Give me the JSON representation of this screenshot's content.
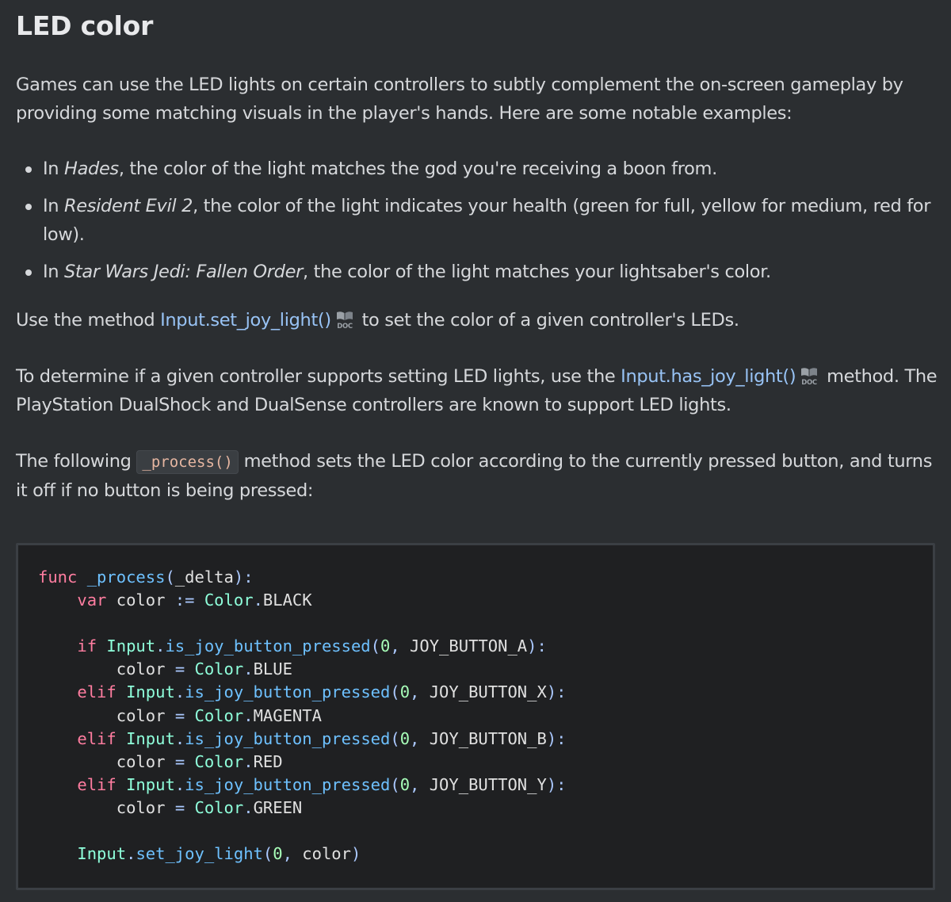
{
  "heading": "LED color",
  "intro": "Games can use the LED lights on certain controllers to subtly complement the on-screen gameplay by providing some matching visuals in the player's hands. Here are some notable examples:",
  "examples": [
    {
      "prefix": "In ",
      "game": "Hades",
      "rest": ", the color of the light matches the god you're receiving a boon from."
    },
    {
      "prefix": "In ",
      "game": "Resident Evil 2",
      "rest": ", the color of the light indicates your health (green for full, yellow for medium, red for low)."
    },
    {
      "prefix": "In ",
      "game": "Star Wars Jedi: Fallen Order",
      "rest": ", the color of the light matches your lightsaber's color."
    }
  ],
  "method_paragraph": {
    "before": "Use the method ",
    "link": "Input.set_joy_light()",
    "after": " to set the color of a given controller's LEDs."
  },
  "has_paragraph": {
    "before": "To determine if a given controller supports setting LED lights, use the ",
    "link": "Input.has_joy_light()",
    "after": " method. The PlayStation DualShock and DualSense controllers are known to support LED lights."
  },
  "process_paragraph": {
    "before": "The following ",
    "code": "_process()",
    "after": " method sets the LED color according to the currently pressed button, and turns it off if no button is being pressed:"
  },
  "doc_badge_label": "DOC",
  "code_lines": [
    "func _process(_delta):",
    "    var color := Color.BLACK",
    "",
    "    if Input.is_joy_button_pressed(0, JOY_BUTTON_A):",
    "        color = Color.BLUE",
    "    elif Input.is_joy_button_pressed(0, JOY_BUTTON_X):",
    "        color = Color.MAGENTA",
    "    elif Input.is_joy_button_pressed(0, JOY_BUTTON_B):",
    "        color = Color.RED",
    "    elif Input.is_joy_button_pressed(0, JOY_BUTTON_Y):",
    "        color = Color.GREEN",
    "",
    "    Input.set_joy_light(0, color)"
  ],
  "colors": {
    "background": "#2b2e31",
    "text": "#d6d8db",
    "link": "#98c3f5",
    "code_background": "#1f2022",
    "keyword": "#ff7da0",
    "function": "#6ec1ff",
    "type": "#8fffdb",
    "number": "#a8ffb9"
  }
}
